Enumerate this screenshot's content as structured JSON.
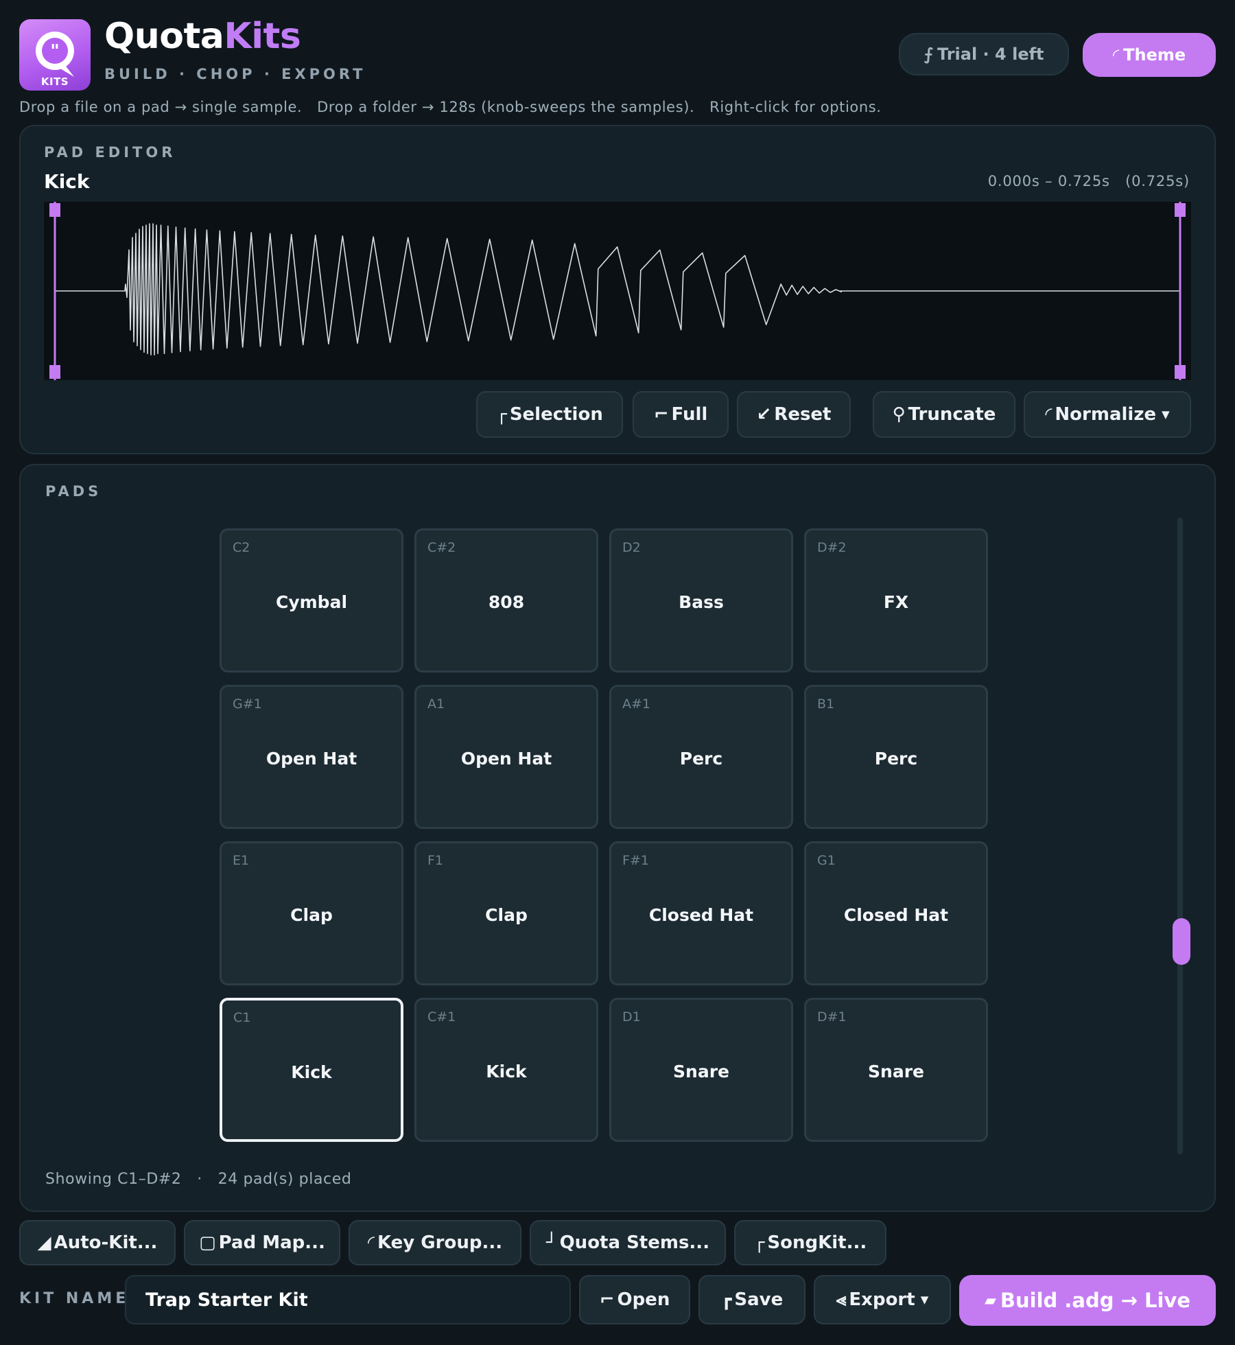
{
  "app": {
    "logo_text": "KITS",
    "brand_part1": "Quota",
    "brand_part2": "Kits",
    "tagline": "BUILD · CHOP · EXPORT",
    "hint": "Drop a file on a pad → single sample.   Drop a folder → 128s (knob-sweeps the samples).   Right-click for options."
  },
  "header": {
    "trial_label": "Trial · 4 left",
    "theme_label": "Theme"
  },
  "colors": {
    "accent": "#c47bf2",
    "background": "#0f171d",
    "panel": "#152128",
    "pad": "#1d2b33",
    "waveform": "#d9dee2"
  },
  "editor": {
    "section_label": "PAD EDITOR",
    "sample_name": "Kick",
    "time_range": "0.000s – 0.725s   (0.725s)",
    "buttons": {
      "selection": "Selection",
      "full": "Full",
      "reset": "Reset",
      "truncate": "Truncate",
      "normalize": "Normalize"
    }
  },
  "pads": {
    "section_label": "PADS",
    "status": "Showing C1–D#2   ·   24 pad(s) placed",
    "selected_note": "C1",
    "rows": [
      [
        {
          "note": "C2",
          "name": "Cymbal"
        },
        {
          "note": "C#2",
          "name": "808"
        },
        {
          "note": "D2",
          "name": "Bass"
        },
        {
          "note": "D#2",
          "name": "FX"
        }
      ],
      [
        {
          "note": "G#1",
          "name": "Open Hat"
        },
        {
          "note": "A1",
          "name": "Open Hat"
        },
        {
          "note": "A#1",
          "name": "Perc"
        },
        {
          "note": "B1",
          "name": "Perc"
        }
      ],
      [
        {
          "note": "E1",
          "name": "Clap"
        },
        {
          "note": "F1",
          "name": "Clap"
        },
        {
          "note": "F#1",
          "name": "Closed Hat"
        },
        {
          "note": "G1",
          "name": "Closed Hat"
        }
      ],
      [
        {
          "note": "C1",
          "name": "Kick"
        },
        {
          "note": "C#1",
          "name": "Kick"
        },
        {
          "note": "D1",
          "name": "Snare"
        },
        {
          "note": "D#1",
          "name": "Snare"
        }
      ]
    ]
  },
  "toolbar": {
    "auto_kit": "Auto-Kit...",
    "pad_map": "Pad Map...",
    "key_group": "Key Group...",
    "quota_stems": "Quota Stems...",
    "songkit": "SongKit..."
  },
  "footer": {
    "kit_name_label": "KIT NAME",
    "kit_name_value": "Trap Starter Kit",
    "open": "Open",
    "save": "Save",
    "export": "Export",
    "build": "Build .adg → Live"
  }
}
